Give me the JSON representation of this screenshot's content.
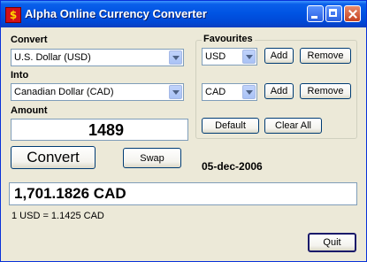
{
  "window": {
    "title": "Alpha Online Currency Converter",
    "icon": "dollar-icon"
  },
  "convert": {
    "label": "Convert",
    "selected": "U.S. Dollar (USD)"
  },
  "into": {
    "label": "Into",
    "selected": "Canadian Dollar (CAD)"
  },
  "amount": {
    "label": "Amount",
    "value": "1489"
  },
  "buttons": {
    "convert": "Convert",
    "swap": "Swap",
    "quit": "Quit"
  },
  "favourites": {
    "title": "Favourites",
    "first": {
      "selected": "USD",
      "add": "Add",
      "remove": "Remove"
    },
    "second": {
      "selected": "CAD",
      "add": "Add",
      "remove": "Remove"
    },
    "default": "Default",
    "clear_all": "Clear All"
  },
  "date": "05-dec-2006",
  "result": "1,701.1826 CAD",
  "rate": "1 USD = 1.1425 CAD"
}
